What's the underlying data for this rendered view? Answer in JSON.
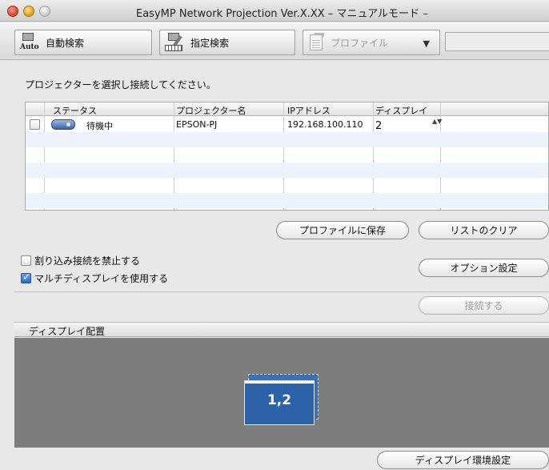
{
  "window": {
    "title": "EasyMP Network Projection Ver.X.XX – マニュアルモード –"
  },
  "toolbar": {
    "auto_search": {
      "icon_text": "Auto",
      "label": "自動検索"
    },
    "manual_search": {
      "label": "指定検索"
    },
    "profile": {
      "label": "プロファイル",
      "arrow": "▼"
    },
    "search_field": {
      "value": ""
    }
  },
  "main": {
    "prompt": "プロジェクターを選択し接続してください。",
    "table": {
      "columns": [
        "ステータス",
        "プロジェクター名",
        "IPアドレス",
        "ディスプレイ"
      ],
      "rows": [
        {
          "checked": false,
          "status": "待機中",
          "name": "EPSON-PJ",
          "ip": "192.168.100.110",
          "display": "2",
          "stepper": "▲▼"
        }
      ]
    },
    "buttons": {
      "save_profile": "プロファイルに保存",
      "clear_list": "リストのクリア",
      "options": "オプション設定",
      "connect": "接続する"
    },
    "options": {
      "disable_interrupt": {
        "label": "割り込み接続を禁止する",
        "checked": false
      },
      "use_multi_display": {
        "label": "マルチディスプレイを使用する",
        "checked": true
      }
    }
  },
  "display_layout": {
    "title": "ディスプレイ配置",
    "display_label": "1,2",
    "settings_button": "ディスプレイ環境設定"
  }
}
